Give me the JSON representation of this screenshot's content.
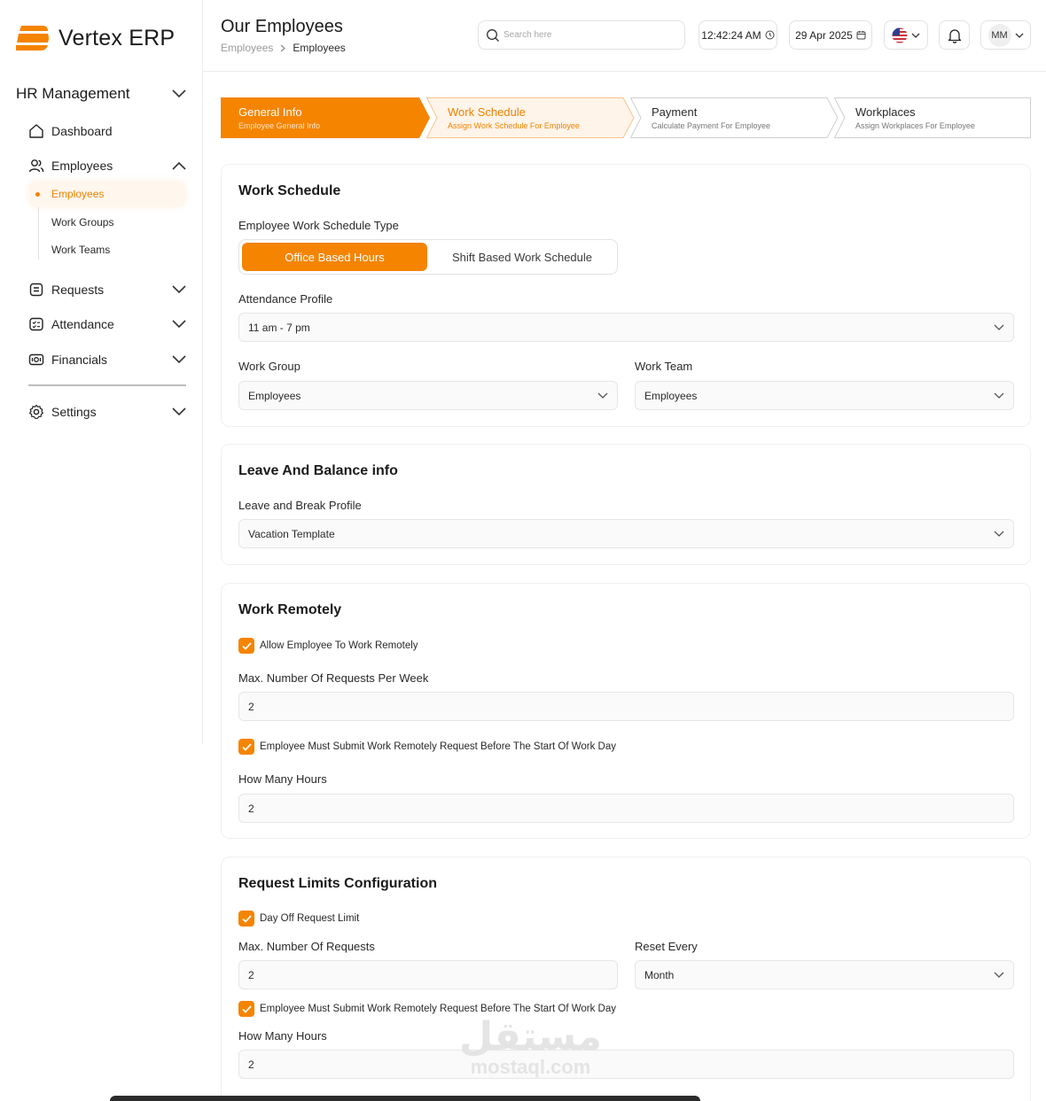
{
  "brand": {
    "name": "Vertex ERP",
    "accent": "#f58400"
  },
  "sidebar": {
    "section_title": "HR Management",
    "items": [
      {
        "label": "Dashboard",
        "icon": "home-icon"
      },
      {
        "label": "Employees",
        "icon": "users-icon"
      },
      {
        "label": "Requests",
        "icon": "clipboard-icon"
      },
      {
        "label": "Attendance",
        "icon": "checklist-icon"
      },
      {
        "label": "Financials",
        "icon": "money-icon"
      },
      {
        "label": "Settings",
        "icon": "gear-icon"
      }
    ],
    "employees_sub": [
      {
        "label": "Employees",
        "active": true
      },
      {
        "label": "Work Groups",
        "active": false
      },
      {
        "label": "Work Teams",
        "active": false
      }
    ]
  },
  "header": {
    "title": "Our Employees",
    "breadcrumb": [
      "Employees",
      "Employees"
    ],
    "search_placeholder": "Search here",
    "time": "12:42:24 AM",
    "date": "29 Apr 2025",
    "user_initials": "MM"
  },
  "steps": [
    {
      "title": "General Info",
      "subtitle": "Employee General Info",
      "state": "done"
    },
    {
      "title": "Work Schedule",
      "subtitle": "Assign Work Schedule For Employee",
      "state": "current"
    },
    {
      "title": "Payment",
      "subtitle": "Calculate Payment For Employee",
      "state": "todo"
    },
    {
      "title": "Workplaces",
      "subtitle": "Assign Workplaces For Employee",
      "state": "todo"
    }
  ],
  "work_schedule": {
    "title": "Work Schedule",
    "type_label": "Employee Work Schedule Type",
    "type_options": [
      "Office Based Hours",
      "Shift Based Work Schedule"
    ],
    "attendance_label": "Attendance Profile",
    "attendance_value": "11 am - 7 pm",
    "work_group_label": "Work Group",
    "work_group_value": "Employees",
    "work_team_label": "Work Team",
    "work_team_value": "Employees"
  },
  "leave": {
    "title": "Leave And Balance info",
    "profile_label": "Leave and Break Profile",
    "profile_value": "Vacation Template"
  },
  "remote": {
    "title": "Work Remotely",
    "allow_label": "Allow Employee To Work Remotely",
    "max_label": "Max. Number Of Requests Per Week",
    "max_value": "2",
    "submit_label": "Employee Must Submit Work Remotely Request Before The Start Of Work Day",
    "hours_label": "How Many Hours",
    "hours_value": "2"
  },
  "limits": {
    "title": "Request Limits Configuration",
    "dayoff_label": "Day Off Request Limit",
    "max_label": "Max. Number Of Requests",
    "max_value": "2",
    "reset_label": "Reset Every",
    "reset_value": "Month",
    "submit_label": "Employee Must Submit Work Remotely Request Before The Start Of Work Day",
    "hours_label": "How Many Hours",
    "hours_value": "2"
  },
  "watermark": {
    "arabic": "مستقل",
    "latin": "mostaql.com"
  }
}
